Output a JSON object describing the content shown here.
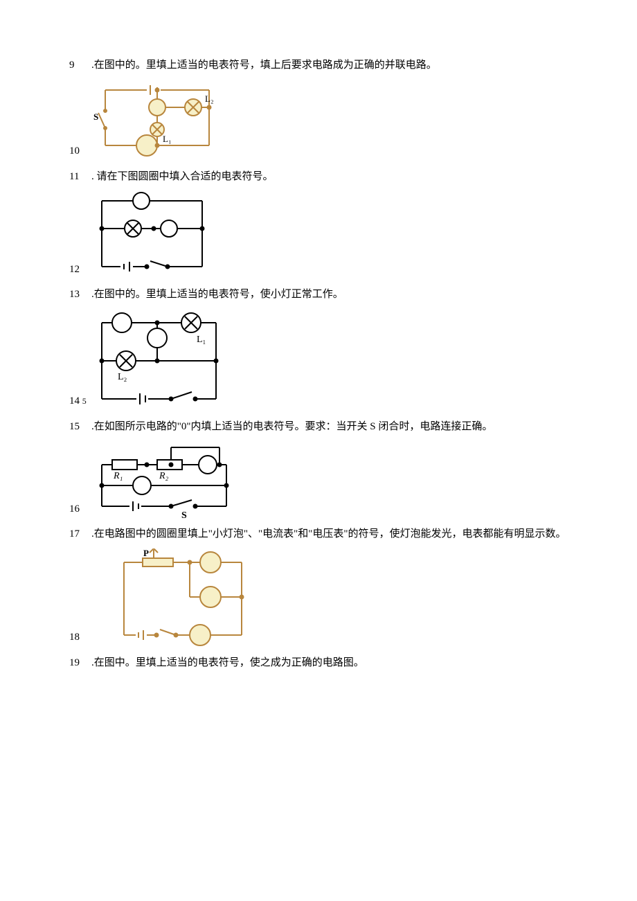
{
  "q9": {
    "num": "9",
    "text": ".在图中的。里填上适当的电表符号，填上后要求电路成为正确的并联电路。"
  },
  "q10": {
    "num": "10"
  },
  "q11": {
    "num": "11",
    "text": ". 请在下图圆圈中填入合适的电表符号。"
  },
  "q12": {
    "num": "12"
  },
  "q13": {
    "num": "13",
    "text": ".在图中的。里填上适当的电表符号，使小灯正常工作。"
  },
  "q14": {
    "num": "14",
    "extra": "5"
  },
  "q15": {
    "num": "15",
    "text": ".在如图所示电路的\"0\"内填上适当的电表符号。要求：当开关 S 闭合时，电路连接正确。"
  },
  "q16": {
    "num": "16"
  },
  "q17": {
    "num": "17",
    "text": ".在电路图中的圆圈里填上\"小灯泡\"、\"电流表\"和\"电压表\"的符号，使灯泡能发光，电表都能有明显示数。"
  },
  "q18": {
    "num": "18"
  },
  "q19": {
    "num": "19",
    "text": ".在图中。里填上适当的电表符号，使之成为正确的电路图。"
  },
  "labels": {
    "L1": "L₁",
    "L2": "L₂",
    "S": "S",
    "R1": "R₁",
    "R2": "R₂",
    "P": "P"
  }
}
